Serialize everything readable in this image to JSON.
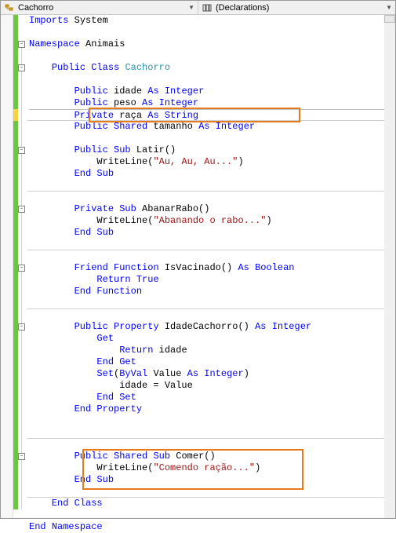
{
  "topbar": {
    "left_label": "Cachorro",
    "right_label": "(Declarations)"
  },
  "code": {
    "l1_imports": "Imports",
    "l1_system": "System",
    "l3_namespace": "Namespace",
    "l3_name": "Animais",
    "l5_public": "Public",
    "l5_class": "Class",
    "l5_cname": "Cachorro",
    "l7_public": "Public",
    "l7_id": "idade",
    "l7_as": "As",
    "l7_type": "Integer",
    "l8_public": "Public",
    "l8_id": "peso",
    "l8_as": "As",
    "l8_type": "Integer",
    "l9_private": "Private",
    "l9_id": "raça",
    "l9_as": "As",
    "l9_type": "String",
    "l10_public": "Public",
    "l10_shared": "Shared",
    "l10_id": "tamanho",
    "l10_as": "As",
    "l10_type": "Integer",
    "l12_public": "Public",
    "l12_sub": "Sub",
    "l12_name": "Latir()",
    "l13_call": "WriteLine(",
    "l13_str": "\"Au, Au, Au...\"",
    "l13_close": ")",
    "l14_end": "End",
    "l14_sub": "Sub",
    "l16_private": "Private",
    "l16_sub": "Sub",
    "l16_name": "AbanarRabo()",
    "l17_call": "WriteLine(",
    "l17_str": "\"Abanando o rabo...\"",
    "l17_close": ")",
    "l18_end": "End",
    "l18_sub": "Sub",
    "l20_friend": "Friend",
    "l20_function": "Function",
    "l20_name": "IsVacinado()",
    "l20_as": "As",
    "l20_type": "Boolean",
    "l21_return": "Return",
    "l21_true": "True",
    "l22_end": "End",
    "l22_function": "Function",
    "l24_public": "Public",
    "l24_property": "Property",
    "l24_name": "IdadeCachorro()",
    "l24_as": "As",
    "l24_type": "Integer",
    "l25_get": "Get",
    "l26_return": "Return",
    "l26_id": "idade",
    "l27_end": "End",
    "l27_get": "Get",
    "l28_set": "Set",
    "l28_open": "(",
    "l28_byval": "ByVal",
    "l28_value": "Value",
    "l28_as": "As",
    "l28_type": "Integer",
    "l28_close": ")",
    "l29_lhs": "idade = Value",
    "l30_end": "End",
    "l30_set": "Set",
    "l31_end": "End",
    "l31_property": "Property",
    "l33_public": "Public",
    "l33_shared": "Shared",
    "l33_sub": "Sub",
    "l33_name": "Comer()",
    "l34_call": "WriteLine(",
    "l34_str": "\"Comendo ração...\"",
    "l34_close": ")",
    "l35_end": "End",
    "l35_sub": "Sub",
    "l37_end": "End",
    "l37_class": "Class",
    "l39_end": "End",
    "l39_namespace": "Namespace"
  }
}
